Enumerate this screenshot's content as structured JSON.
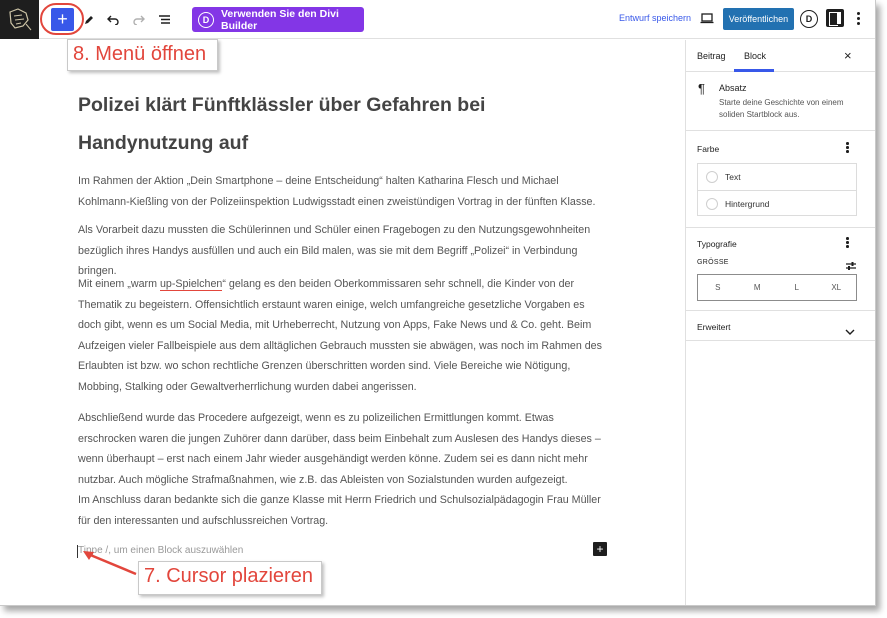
{
  "toolbar": {
    "add_block_icon": "plus-icon",
    "divi_badge": "D",
    "divi_builder_label": "Verwenden Sie den Divi Builder",
    "save_draft_label": "Entwurf speichern",
    "publish_label": "Veröffentlichen",
    "divi_circle_label": "D",
    "accent_color": "#3858e9",
    "divi_color": "#8336e6",
    "publish_color": "#2271b1"
  },
  "annotations": {
    "menu_callout": "8. Menü öffnen",
    "cursor_callout": "7. Cursor plazieren",
    "callout_color": "#e2463c"
  },
  "editor": {
    "title": "Polizei klärt Fünftklässler über Gefahren bei Handynutzung auf",
    "paragraphs": {
      "p1": "Im Rahmen der Aktion „Dein Smartphone – deine Entscheidung“ halten Katharina Flesch und Michael Kohlmann-Kießling von der Polizeiinspektion Ludwigsstadt einen zweistündigen Vortrag in der fünften Klasse.",
      "p2": "Als Vorarbeit dazu mussten die Schülerinnen und Schüler einen Fragebogen zu den Nutzungsgewohnheiten bezüglich ihres Handys ausfüllen und auch ein Bild malen, was sie mit dem Begriff „Polizei“ in Verbindung bringen.",
      "p3_before": "Mit einem „warm ",
      "p3_link": "up-Spielchen",
      "p3_after": "“ gelang es den beiden Oberkommissaren sehr schnell, die Kinder von der Thematik zu begeistern. Offensichtlich erstaunt waren einige, welch umfangreiche gesetzliche Vorgaben es doch gibt, wenn es um Social Media, mit Urheberrecht, Nutzung von Apps, Fake News und & Co. geht. Beim Aufzeigen vieler Fallbeispiele aus dem alltäglichen Gebrauch mussten sie abwägen, was noch im Rahmen des Erlaubten ist bzw. wo schon rechtliche Grenzen überschritten worden sind. Viele Bereiche wie Nötigung, Mobbing, Stalking oder Gewaltverherrlichung wurden dabei angerissen.",
      "p4_a": "Abschließend wurde das Procedere aufgezeigt, wenn es zu polizeilichen Ermittlungen kommt. Etwas erschrocken waren die jungen Zuhörer dann darüber, dass beim Einbehalt zum Auslesen des Handys dieses – wenn überhaupt – erst nach einem Jahr wieder ausgehändigt werden könne. Zudem sei es dann nicht mehr nutzbar. Auch mögliche Strafmaßnahmen, wie z.B. das Ableisten von Sozialstunden wurden aufgezeigt.",
      "p4_b": "Im Anschluss daran bedankte sich die ganze Klasse mit Herrn Friedrich und Schulsozialpädagogin Frau Müller für den interessanten und aufschlussreichen Vortrag."
    },
    "placeholder": "Tippe /, um einen Block auszuwählen",
    "inline_add_label": "+"
  },
  "sidebar": {
    "tab_post": "Beitrag",
    "tab_block": "Block",
    "close_label": "×",
    "block_icon": "paragraph-icon",
    "block_name": "Absatz",
    "block_desc": "Starte deine Geschichte von einem soliden Startblock aus.",
    "color_panel_title": "Farbe",
    "color_text": "Text",
    "color_background": "Hintergrund",
    "typography_title": "Typografie",
    "size_label": "GRÖSSE",
    "sizes": {
      "s": "S",
      "m": "M",
      "l": "L",
      "xl": "XL"
    },
    "advanced_title": "Erweitert"
  }
}
